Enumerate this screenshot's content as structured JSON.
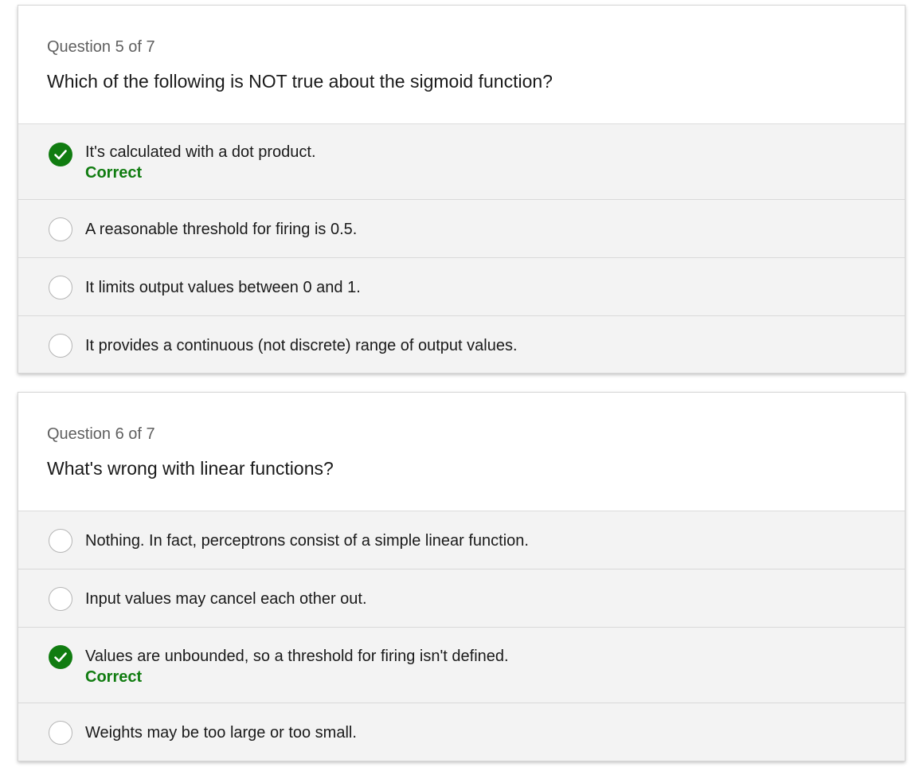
{
  "questions": [
    {
      "counter": "Question 5 of 7",
      "text": "Which of the following is NOT true about the sigmoid function?",
      "options": [
        {
          "label": "It's calculated with a dot product.",
          "selected": true,
          "feedback": "Correct"
        },
        {
          "label": "A reasonable threshold for firing is 0.5.",
          "selected": false
        },
        {
          "label": "It limits output values between 0 and 1.",
          "selected": false
        },
        {
          "label": "It provides a continuous (not discrete) range of output values.",
          "selected": false
        }
      ]
    },
    {
      "counter": "Question 6 of 7",
      "text": "What's wrong with linear functions?",
      "options": [
        {
          "label": "Nothing. In fact, perceptrons consist of a simple linear function.",
          "selected": false
        },
        {
          "label": "Input values may cancel each other out.",
          "selected": false
        },
        {
          "label": "Values are unbounded, so a threshold for firing isn't defined.",
          "selected": true,
          "feedback": "Correct"
        },
        {
          "label": "Weights may be too large or too small.",
          "selected": false
        }
      ]
    }
  ],
  "colors": {
    "correct_green": "#107c10",
    "option_background": "#f3f3f3",
    "counter_gray": "#606060"
  },
  "icons": {
    "selected": "check-circle-icon",
    "unselected": "radio-circle-icon"
  }
}
